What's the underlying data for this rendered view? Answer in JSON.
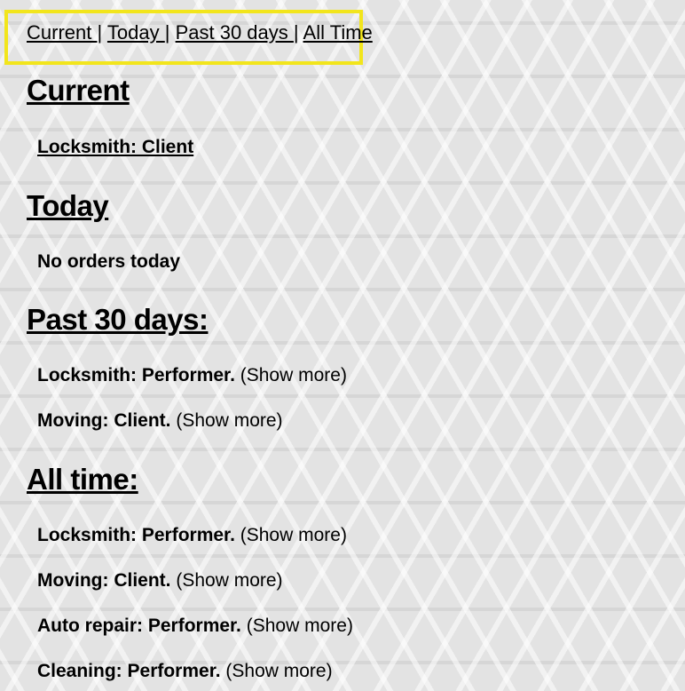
{
  "nav": {
    "current": "Current ",
    "today": "Today ",
    "past30": "Past 30 days ",
    "alltime": "All Time",
    "separator": "|"
  },
  "sections": {
    "current": {
      "heading": "Current",
      "items": [
        {
          "text": "Locksmith: Client"
        }
      ]
    },
    "today": {
      "heading": "Today",
      "empty": "No orders today"
    },
    "past30": {
      "heading": "Past 30 days:",
      "items": [
        {
          "role": "Locksmith: Performer.",
          "more": "(Show more)"
        },
        {
          "role": "Moving: Client.",
          "more": "(Show more)"
        }
      ]
    },
    "alltime": {
      "heading": "All time:",
      "items": [
        {
          "role": "Locksmith: Performer.",
          "more": "(Show more)"
        },
        {
          "role": "Moving: Client.",
          "more": "(Show more)"
        },
        {
          "role": "Auto repair: Performer.",
          "more": "(Show more)"
        },
        {
          "role": "Cleaning: Performer.",
          "more": "(Show more)"
        }
      ]
    }
  },
  "colors": {
    "highlight_border": "#f2e51c",
    "background": "#e3e3e3"
  }
}
